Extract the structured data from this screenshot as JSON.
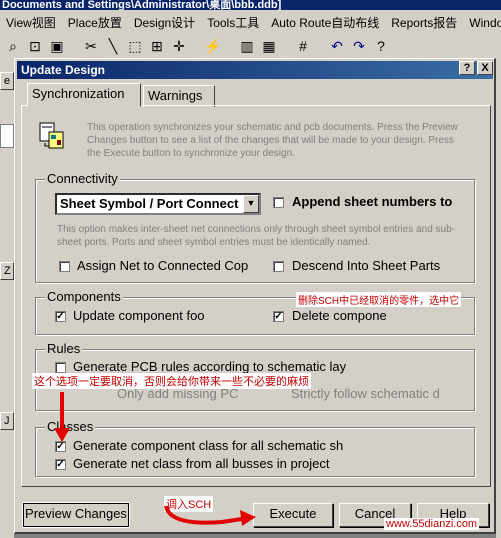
{
  "app": {
    "title": "Documents and Settings\\Administrator\\桌面\\bbb.ddb]",
    "menu": [
      "View视图",
      "Place放置",
      "Design设计",
      "Tools工具",
      "Auto Route自动布线",
      "Reports报告",
      "Window"
    ],
    "side_letters": [
      "e",
      "Z",
      "J"
    ]
  },
  "dialog": {
    "title": "Update Design",
    "help_caption": "?",
    "close_caption": "X",
    "tabs": [
      "Synchronization",
      "Warnings"
    ],
    "intro": "This operation synchronizes your schematic and pcb documents.  Press the Preview Changes button to see a list of the changes that will be made to your design.  Press the Execute button to synchronize your design.",
    "connectivity": {
      "label": "Connectivity",
      "combo_value": "Sheet Symbol / Port Connect",
      "append_label": "Append sheet numbers to",
      "info": "This option makes inter-sheet net connections only through sheet symbol entries and sub-sheet ports. Ports and sheet symbol entries must be identically named.",
      "assign_net_label": "Assign Net to Connected Cop",
      "descend_label": "Descend Into Sheet Parts"
    },
    "components": {
      "label": "Components",
      "update_label": "Update component foo",
      "delete_label": "Delete compone"
    },
    "rules": {
      "label": "Rules",
      "generate_pcb_label": "Generate PCB rules according to schematic lay",
      "only_add_label": "Only add missing PC",
      "strictly_label": "Strictly follow schematic d"
    },
    "classes": {
      "label": "Classes",
      "component_class_label": "Generate component class for all schematic sh",
      "net_class_label": "Generate net class from all busses in project"
    },
    "buttons": {
      "preview": "Preview Changes",
      "execute": "Execute",
      "cancel": "Cancel",
      "help": "Help"
    }
  },
  "annotations": {
    "delete_note": "删除SCH中已经取消的零件，选中它",
    "rules_note": "这个选项一定要取消，否则会给你带来一些不必要的麻烦",
    "execute_note": "调入SCH",
    "watermark": "www.55dianzi.com",
    "arrow_color": "#e00000"
  }
}
